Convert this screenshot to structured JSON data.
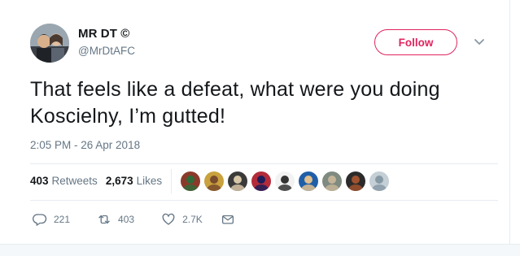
{
  "user": {
    "display_name": "MR DT ©",
    "handle": "@MrDtAFC",
    "avatar_icon": "profile-photo"
  },
  "follow_button": {
    "label": "Follow",
    "color": "#e0245e"
  },
  "menu_caret_icon": "chevron-down-icon",
  "tweet": {
    "text": "That feels like a defeat, what were you doing Koscielny, I’m gutted!",
    "timestamp": "2:05 PM - 26 Apr 2018"
  },
  "stats": {
    "retweets_count": "403",
    "retweets_label": "Retweets",
    "likes_count": "2,673",
    "likes_label": "Likes"
  },
  "liker_avatars": [
    {
      "colors": [
        "#8b3a2a",
        "#2f6b3a"
      ]
    },
    {
      "colors": [
        "#c9a13d",
        "#7a4b2c"
      ]
    },
    {
      "colors": [
        "#3a3a3a",
        "#d8c6a8"
      ]
    },
    {
      "colors": [
        "#b32b3a",
        "#1d1d5a"
      ]
    },
    {
      "colors": [
        "#f2f2f2",
        "#333333"
      ]
    },
    {
      "colors": [
        "#1f5fa8",
        "#e0c090"
      ]
    },
    {
      "colors": [
        "#7f8a80",
        "#c4b498"
      ]
    },
    {
      "colors": [
        "#2b2b2b",
        "#a0522d"
      ]
    },
    {
      "colors": [
        "#c4cfd6",
        "#8899a6"
      ]
    }
  ],
  "actions": {
    "reply_count": "221",
    "retweet_count": "403",
    "like_count": "2.7K"
  },
  "colors": {
    "text_primary": "#14171a",
    "text_secondary": "#657786",
    "border": "#e6ecf0",
    "follow_accent": "#e0245e"
  }
}
